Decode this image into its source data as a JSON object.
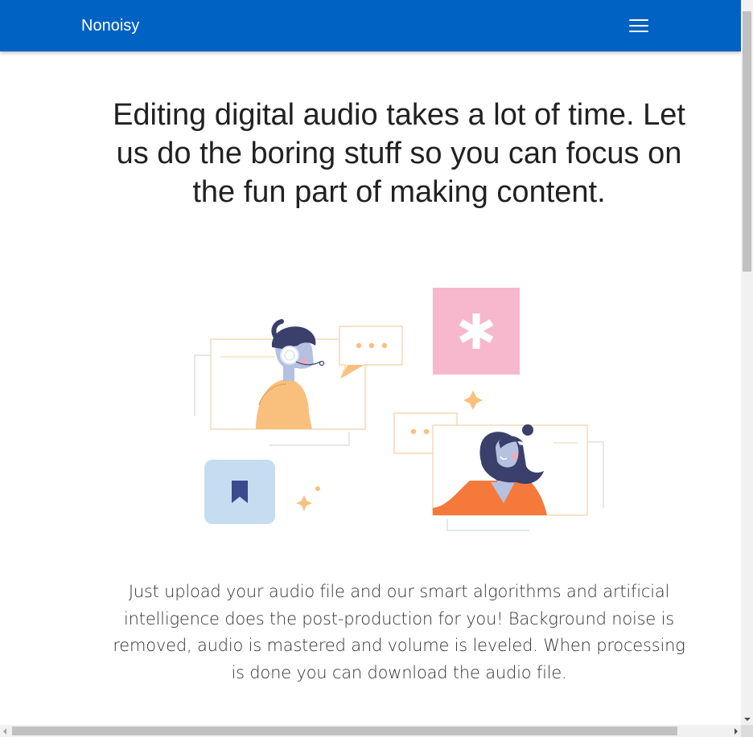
{
  "navbar": {
    "brand": "Nonoisy",
    "background": "#0062c2",
    "menu_icon": "hamburger-menu-icon"
  },
  "hero": {
    "headline": "Editing digital audio takes a lot of time. Let us do the boring stuff so you can focus on the fun part of making content.",
    "illustration": {
      "icons": [
        "asterisk-icon",
        "bookmark-icon",
        "sparkle-icon",
        "chat-bubble-icon"
      ],
      "colors": {
        "pink": "#f7b7cc",
        "light_blue": "#c6dcf1",
        "orange": "#f5793a",
        "peach": "#f9c07d",
        "navy": "#3a3f6b",
        "skin": "#b4c1e0",
        "outline": "#f5cfa6"
      }
    },
    "description": "Just upload your audio file and our smart algorithms and artificial intelligence does the post-production for you! Background noise is removed, audio is mastered and volume is leveled. When processing is done you can download the audio file."
  }
}
